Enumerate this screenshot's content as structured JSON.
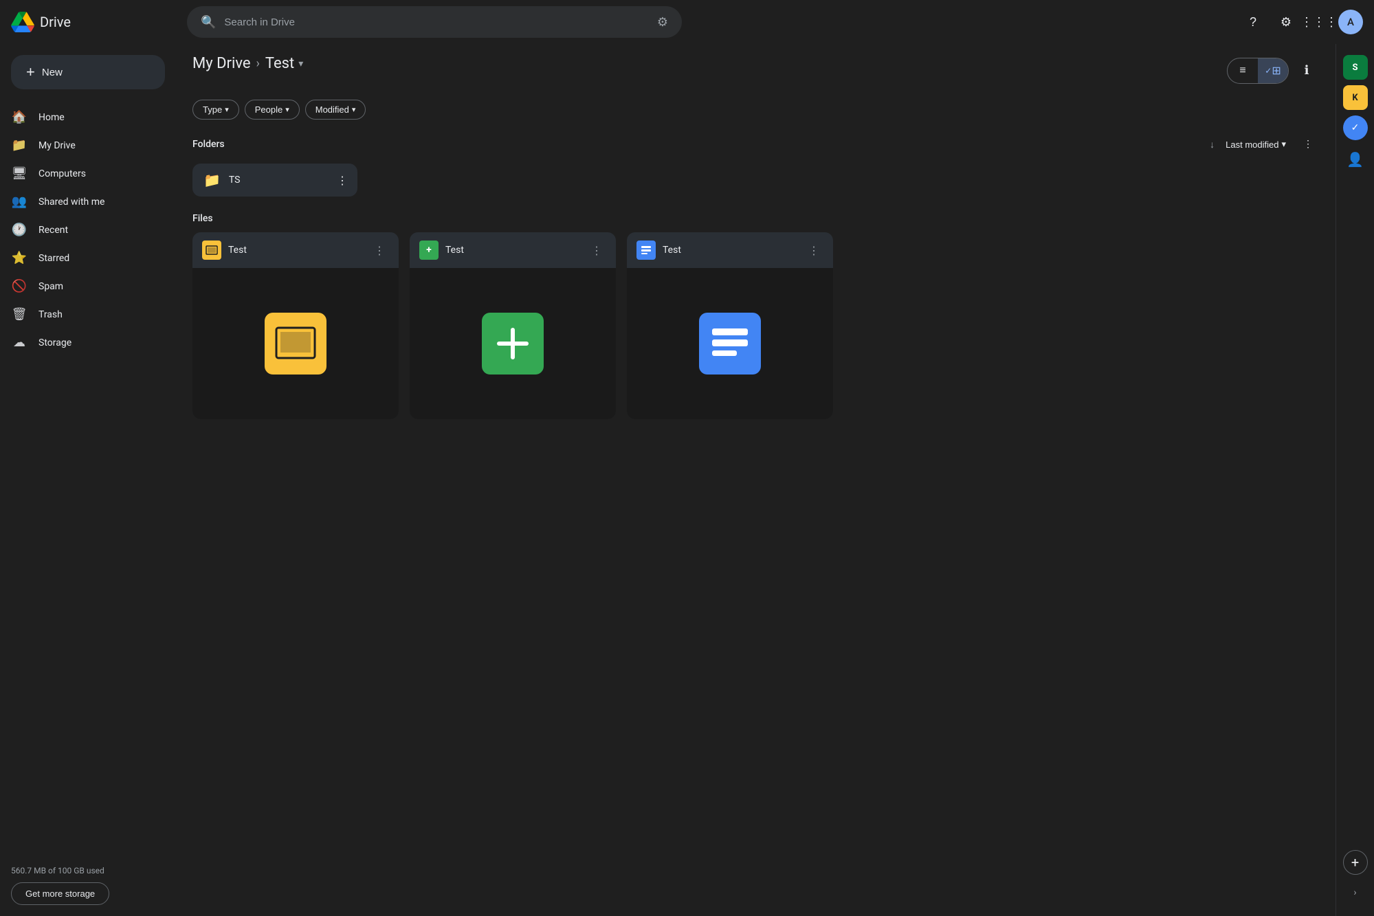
{
  "header": {
    "logo_text": "Drive",
    "search_placeholder": "Search in Drive",
    "help_label": "Help",
    "settings_label": "Settings",
    "apps_label": "Apps",
    "avatar_label": "Account"
  },
  "sidebar": {
    "new_button": "New",
    "nav_items": [
      {
        "id": "home",
        "label": "Home",
        "icon": "🏠"
      },
      {
        "id": "my-drive",
        "label": "My Drive",
        "icon": "📁"
      },
      {
        "id": "computers",
        "label": "Computers",
        "icon": "🖥"
      },
      {
        "id": "shared",
        "label": "Shared with me",
        "icon": "👥"
      },
      {
        "id": "recent",
        "label": "Recent",
        "icon": "🕐"
      },
      {
        "id": "starred",
        "label": "Starred",
        "icon": "⭐"
      },
      {
        "id": "spam",
        "label": "Spam",
        "icon": "🚫"
      },
      {
        "id": "trash",
        "label": "Trash",
        "icon": "🗑"
      },
      {
        "id": "storage",
        "label": "Storage",
        "icon": "☁"
      }
    ],
    "storage_text": "560.7 MB of 100 GB used",
    "get_storage_label": "Get more storage"
  },
  "breadcrumb": {
    "root": "My Drive",
    "separator": "›",
    "current": "Test",
    "caret": "▾"
  },
  "filters": {
    "type_label": "Type",
    "people_label": "People",
    "modified_label": "Modified",
    "caret": "▾"
  },
  "view_controls": {
    "list_icon": "≡",
    "grid_icon": "⊞",
    "info_icon": "ℹ"
  },
  "sort": {
    "section_folders": "Folders",
    "section_files": "Files",
    "sort_label": "Last modified",
    "sort_caret": "▾",
    "down_arrow": "↓"
  },
  "folders": [
    {
      "id": "ts",
      "name": "TS"
    }
  ],
  "files": [
    {
      "id": "slides-test",
      "name": "Test",
      "type": "slides",
      "type_label": "▶"
    },
    {
      "id": "forms-test",
      "name": "Test",
      "type": "forms",
      "type_label": "+"
    },
    {
      "id": "docs-test",
      "name": "Test",
      "type": "docs",
      "type_label": "≡"
    }
  ],
  "right_panel": {
    "sheets_icon": "S",
    "keep_icon": "K",
    "tasks_icon": "✓",
    "contacts_icon": "👤",
    "add_icon": "+",
    "chevron": "›"
  }
}
